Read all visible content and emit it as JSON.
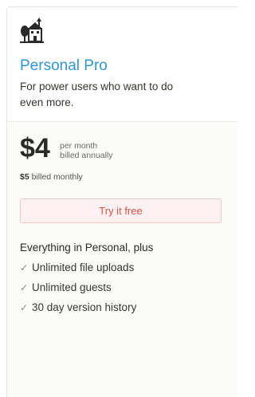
{
  "plan": {
    "icon": "building-icon",
    "name": "Personal Pro",
    "description": "For power users who want to do even more.",
    "price": "$4",
    "price_note_line1": "per month",
    "price_note_line2": "billed annually",
    "monthly_price": "$5",
    "monthly_text": "billed monthly",
    "cta_label": "Try it free",
    "features_heading": "Everything in Personal, plus",
    "features": [
      "Unlimited file uploads",
      "Unlimited guests",
      "30 day version history"
    ]
  },
  "colors": {
    "plan_name": "#2f95d6",
    "cta_text": "#e0504a",
    "cta_background": "#fdf2f1",
    "cta_border": "#f0c7c5"
  }
}
